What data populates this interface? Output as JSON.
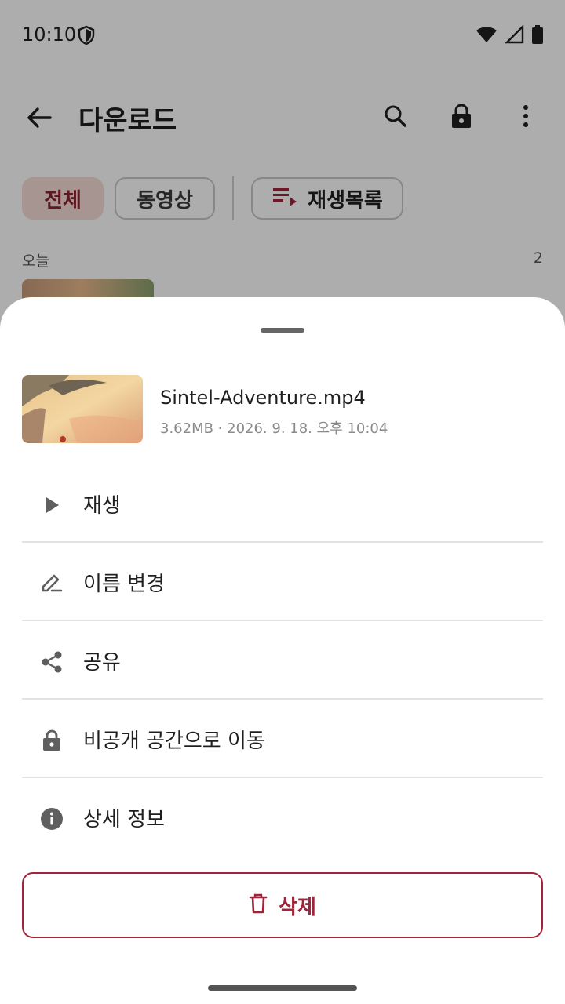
{
  "status_bar": {
    "time": "10:10"
  },
  "app_bar": {
    "title": "다운로드"
  },
  "filters": {
    "all": "전체",
    "video": "동영상",
    "playlist": "재생목록"
  },
  "section": {
    "label": "오늘",
    "count": "2"
  },
  "sheet": {
    "file_name": "Sintel-Adventure.mp4",
    "file_meta": "3.62MB · 2026. 9. 18. 오후 10:04",
    "actions": [
      {
        "label": "재생",
        "icon": "play-icon"
      },
      {
        "label": "이름 변경",
        "icon": "edit-icon"
      },
      {
        "label": "공유",
        "icon": "share-icon"
      },
      {
        "label": "비공개 공간으로 이동",
        "icon": "lock-icon"
      },
      {
        "label": "상세 정보",
        "icon": "info-icon"
      }
    ],
    "delete_label": "삭제"
  },
  "colors": {
    "accent": "#a0243a",
    "chip_selected_bg": "#f6dcd8",
    "scrim": "rgba(0,0,0,0.32)"
  }
}
